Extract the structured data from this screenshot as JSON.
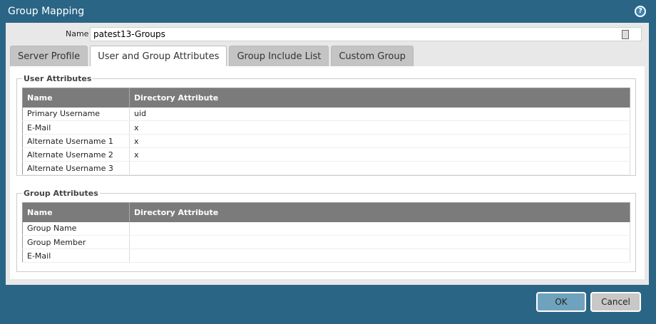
{
  "title": "Group Mapping",
  "name_label": "Name",
  "name_value": "patest13-Groups",
  "tabs": [
    "Server Profile",
    "User and Group Attributes",
    "Group Include List",
    "Custom Group"
  ],
  "user_attributes": {
    "legend": "User Attributes",
    "headers": [
      "Name",
      "Directory Attribute"
    ],
    "rows": [
      [
        "Primary Username",
        "uid"
      ],
      [
        "E-Mail",
        "x"
      ],
      [
        "Alternate Username 1",
        "x"
      ],
      [
        "Alternate Username 2",
        "x"
      ],
      [
        "Alternate Username 3",
        ""
      ]
    ]
  },
  "group_attributes": {
    "legend": "Group Attributes",
    "headers": [
      "Name",
      "Directory Attribute"
    ],
    "rows": [
      [
        "Group Name",
        ""
      ],
      [
        "Group Member",
        ""
      ],
      [
        "E-Mail",
        ""
      ]
    ]
  },
  "buttons": {
    "ok": "OK",
    "cancel": "Cancel"
  }
}
